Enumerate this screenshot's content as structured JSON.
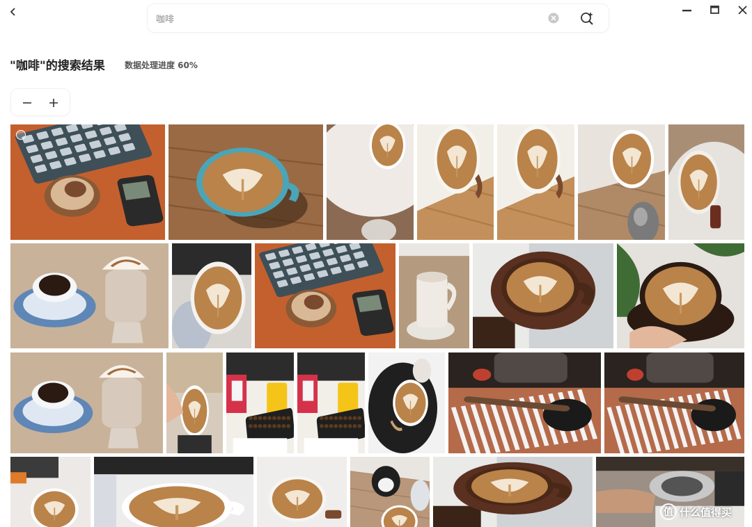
{
  "search": {
    "query": "咖啡"
  },
  "header": {
    "result_title": "\"咖啡\"的搜索结果",
    "progress_text": "数据处理进度 60%"
  },
  "watermark": {
    "text": "什么值得买",
    "logo": "值"
  },
  "photos": [
    {
      "kind": "keyboard_orange"
    },
    {
      "kind": "cup_blue_wood"
    },
    {
      "kind": "latte_white_table"
    },
    {
      "kind": "latte_wood_bright"
    },
    {
      "kind": "latte_wood_bright"
    },
    {
      "kind": "latte_cat"
    },
    {
      "kind": "latte_round_table"
    },
    {
      "kind": "espresso_and_float"
    },
    {
      "kind": "latte_top_grey"
    },
    {
      "kind": "keyboard_orange"
    },
    {
      "kind": "white_mug"
    },
    {
      "kind": "latte_brown_cup"
    },
    {
      "kind": "latte_hand_plant"
    },
    {
      "kind": "espresso_and_float"
    },
    {
      "kind": "latte_hand_beige"
    },
    {
      "kind": "beans_juice"
    },
    {
      "kind": "beans_juice"
    },
    {
      "kind": "latte_dark_plate"
    },
    {
      "kind": "espresso_machine"
    },
    {
      "kind": "espresso_machine"
    },
    {
      "kind": "latte_small_dark"
    },
    {
      "kind": "latte_white_big"
    },
    {
      "kind": "latte_brown_mug"
    },
    {
      "kind": "cat_latte"
    },
    {
      "kind": "latte_brown_cup"
    },
    {
      "kind": "espresso_machine_hand"
    }
  ]
}
